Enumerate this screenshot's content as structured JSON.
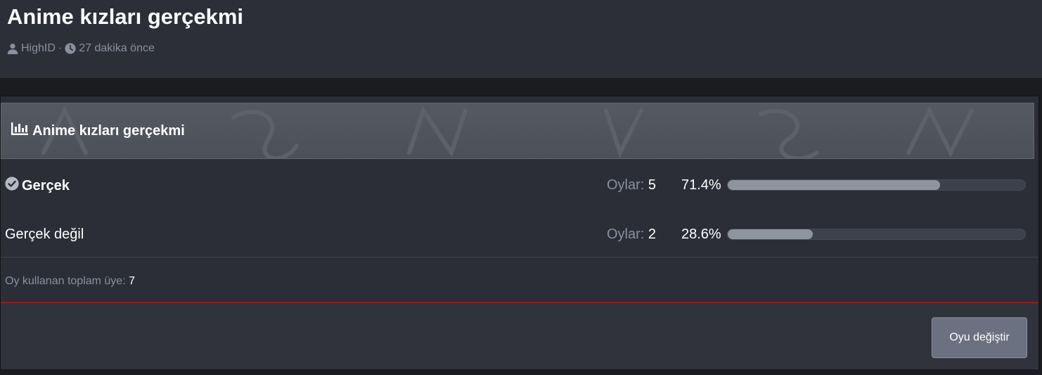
{
  "thread": {
    "title": "Anime kızları gerçekmi",
    "author": "HighID",
    "separator": "·",
    "time": "27 dakika önce"
  },
  "poll": {
    "title": "Anime kızları gerçekmi",
    "votes_label": "Oylar:",
    "responses": [
      {
        "label": "Gerçek",
        "votes": "5",
        "percent": "71.4%",
        "fraction": 0.714,
        "voted": true
      },
      {
        "label": "Gerçek değil",
        "votes": "2",
        "percent": "28.6%",
        "fraction": 0.286,
        "voted": false
      }
    ],
    "total_label": "Oy kullanan toplam üye:",
    "total_value": "7",
    "change_vote_button": "Oyu değiştir"
  },
  "colors": {
    "accent_border": "#8a1f22",
    "bar_fill": "#8f959f",
    "muted_text": "#8a90a0"
  },
  "icons": {
    "author": "user-icon",
    "time": "clock-icon",
    "poll": "bar-chart-icon",
    "voted": "check-circle-icon"
  }
}
